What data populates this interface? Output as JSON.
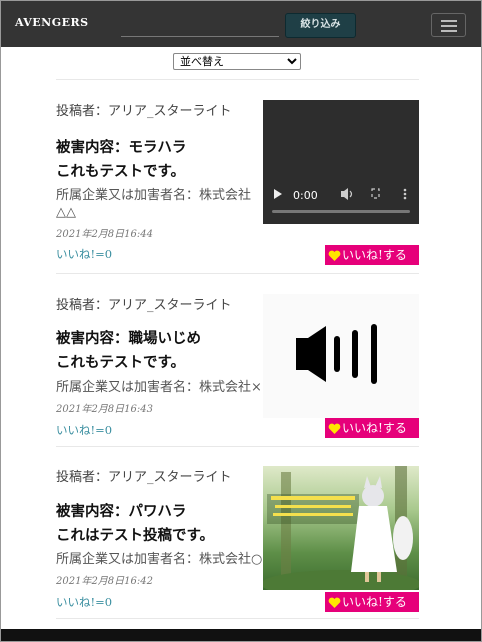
{
  "navbar": {
    "brand": "AVENGERS",
    "search_placeholder": "",
    "search_button": "絞り込み",
    "menu_icon": "hamburger-icon"
  },
  "sort": {
    "selected": "並べ替え"
  },
  "posts": [
    {
      "poster": "投稿者：アリア_スターライト",
      "damage": "被害内容：モラハラ",
      "body": "これもテストです。",
      "company": "所属企業又は加害者名：株式会社△△",
      "date": "2021年2月8日16:44",
      "likes": "いいね!=0",
      "like_button": "いいね!する",
      "media": {
        "type": "video",
        "time": "0:00"
      }
    },
    {
      "poster": "投稿者：アリア_スターライト",
      "damage": "被害内容：職場いじめ",
      "body": "これもテストです。",
      "company": "所属企業又は加害者名：株式会社××",
      "date": "2021年2月8日16:43",
      "likes": "いいね!=0",
      "like_button": "いいね!する",
      "media": {
        "type": "audio",
        "icon": "speaker-icon"
      }
    },
    {
      "poster": "投稿者：アリア_スターライト",
      "damage": "被害内容：パワハラ",
      "body": "これはテスト投稿です。",
      "company": "所属企業又は加害者名：株式会社○○",
      "date": "2021年2月8日16:42",
      "likes": "いいね!=0",
      "like_button": "いいね!する",
      "media": {
        "type": "image"
      }
    }
  ],
  "colors": {
    "navbar": "#343434",
    "like_button": "#e6007a",
    "likes_text": "#3b8fa0"
  }
}
